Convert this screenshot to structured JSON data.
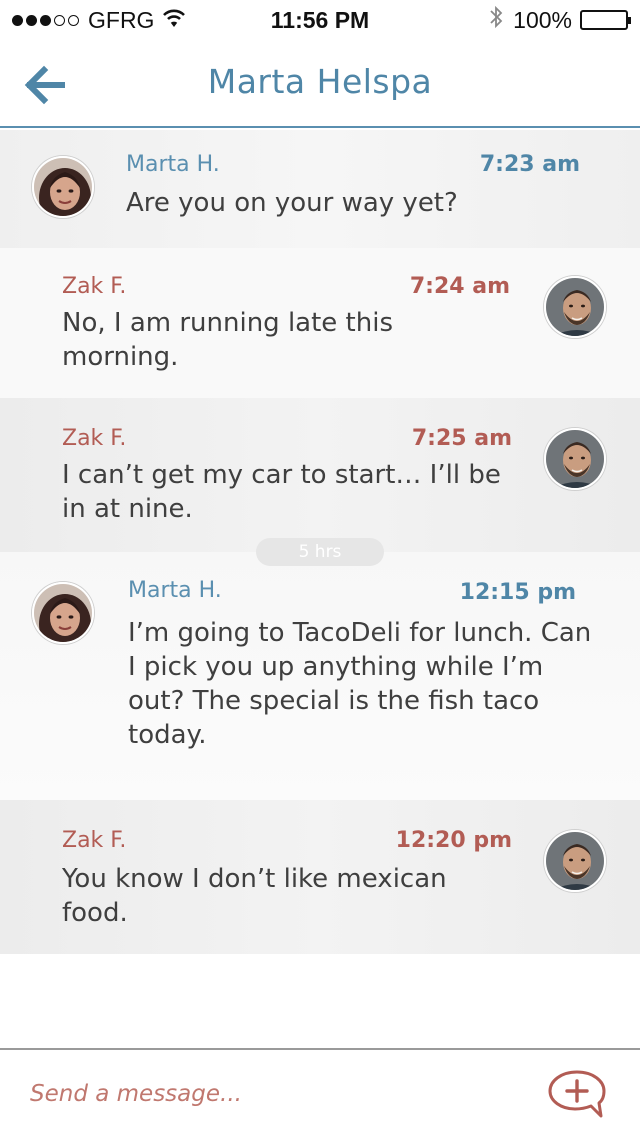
{
  "status_bar": {
    "carrier": "GFRG",
    "time": "11:56 PM",
    "battery": "100%",
    "signal_filled": 3,
    "signal_total": 5
  },
  "nav": {
    "title": "Marta Helspa"
  },
  "messages": [
    {
      "sender": "Marta H.",
      "time": "7:23 am",
      "text": "Are you on your way yet?"
    },
    {
      "sender": "Zak F.",
      "time": "7:24 am",
      "text": "No, I am running late this morning."
    },
    {
      "sender": "Zak F.",
      "time": "7:25 am",
      "text": "I can’t get my car to start… I’ll be in at nine."
    },
    {
      "sender": "Marta H.",
      "time": "12:15 pm",
      "text": "I’m going to TacoDeli for lunch. Can I pick you up anything while I’m out?  The special is the fish taco today."
    },
    {
      "sender": "Zak F.",
      "time": "12:20 pm",
      "text": "You know I don’t like mexican food."
    }
  ],
  "time_gap": "5 hrs",
  "composer": {
    "placeholder": "Send a message..."
  },
  "colors": {
    "marta": "#4f86a7",
    "zak": "#b25c54"
  }
}
